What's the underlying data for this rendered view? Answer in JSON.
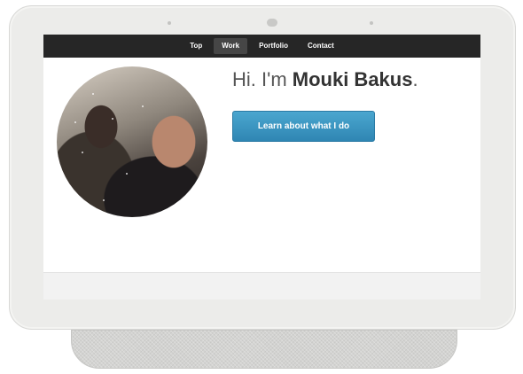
{
  "nav": {
    "items": [
      {
        "label": "Top",
        "active": false
      },
      {
        "label": "Work",
        "active": true
      },
      {
        "label": "Portfolio",
        "active": false
      },
      {
        "label": "Contact",
        "active": false
      }
    ]
  },
  "hero": {
    "greeting": "Hi. I'm ",
    "name": "Mouki Bakus",
    "punct": ".",
    "cta_label": "Learn about what I do"
  },
  "colors": {
    "navbar": "#262626",
    "nav_active": "#464646",
    "cta": "#3a93c1",
    "device": "#ececea"
  }
}
